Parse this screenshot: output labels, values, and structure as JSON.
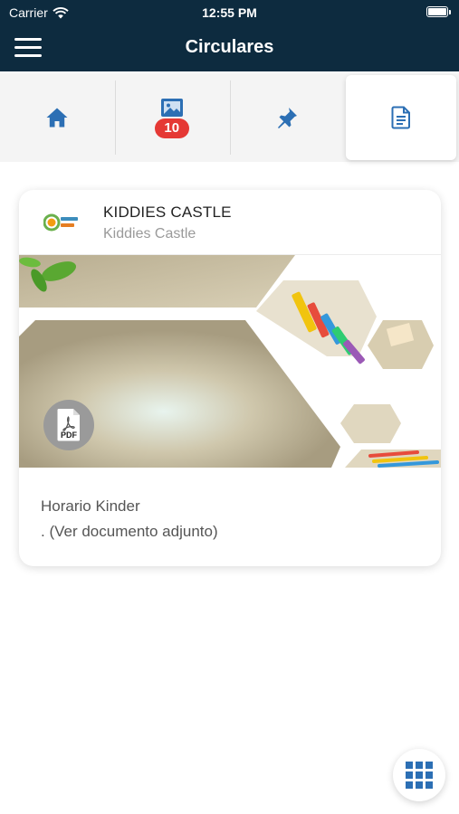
{
  "status_bar": {
    "carrier": "Carrier",
    "time": "12:55 PM"
  },
  "header": {
    "title": "Circulares"
  },
  "tabs": [
    {
      "icon": "home-icon"
    },
    {
      "icon": "gallery-icon",
      "badge": "10"
    },
    {
      "icon": "pin-icon"
    },
    {
      "icon": "document-icon",
      "active": true
    }
  ],
  "post": {
    "org_name": "KIDDIES CASTLE",
    "org_subtitle": "Kiddies Castle",
    "attachment_label": "PDF",
    "title": "Horario Kinder",
    "description": ". (Ver documento adjunto)"
  },
  "colors": {
    "primary": "#0d2b3f",
    "accent": "#2c6fb4",
    "badge": "#e53935"
  }
}
